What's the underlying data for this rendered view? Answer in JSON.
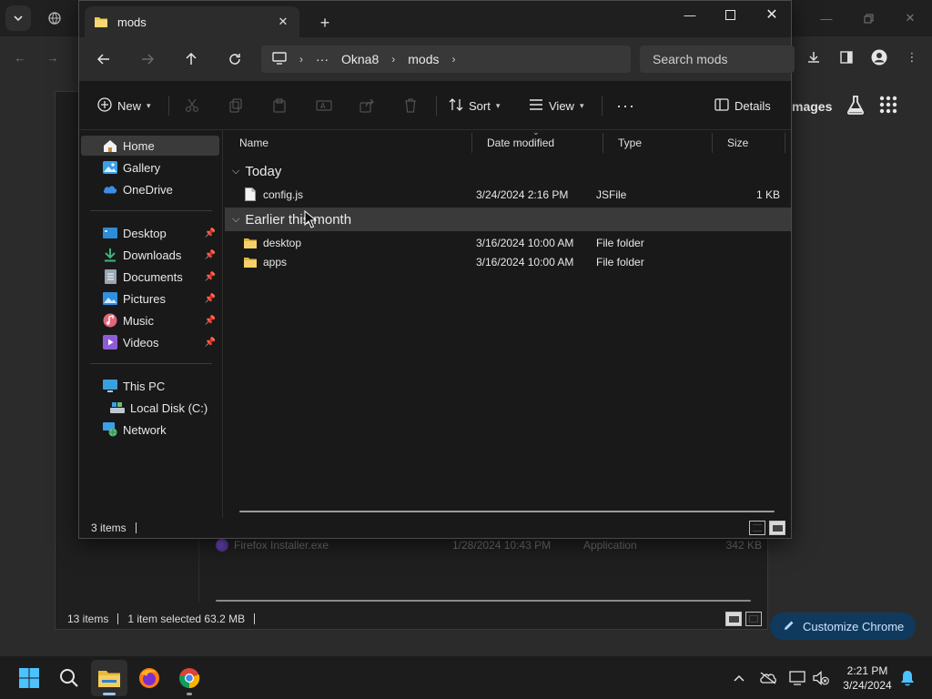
{
  "explorer": {
    "tab_title": "mods",
    "address": {
      "crumbs": [
        "Okna8",
        "mods"
      ]
    },
    "search_placeholder": "Search mods",
    "commands": {
      "new": "New",
      "sort": "Sort",
      "view": "View",
      "details": "Details"
    },
    "nav": {
      "home": "Home",
      "gallery": "Gallery",
      "onedrive": "OneDrive",
      "desktop": "Desktop",
      "downloads": "Downloads",
      "documents": "Documents",
      "pictures": "Pictures",
      "music": "Music",
      "videos": "Videos",
      "thispc": "This PC",
      "localdisk": "Local Disk (C:)",
      "network": "Network"
    },
    "columns": {
      "name": "Name",
      "date": "Date modified",
      "type": "Type",
      "size": "Size"
    },
    "groups": [
      {
        "label": "Today",
        "files": [
          {
            "name": "config.js",
            "date": "3/24/2024 2:16 PM",
            "type": "JSFile",
            "size": "1 KB"
          }
        ]
      },
      {
        "label": "Earlier this month",
        "files": [
          {
            "name": "desktop",
            "date": "3/16/2024 10:00 AM",
            "type": "File folder",
            "size": ""
          },
          {
            "name": "apps",
            "date": "3/16/2024 10:00 AM",
            "type": "File folder",
            "size": ""
          }
        ]
      }
    ],
    "status": "3 items"
  },
  "background": {
    "images_link": "mages",
    "row": {
      "name": "Firefox Installer.exe",
      "date": "1/28/2024 10:43 PM",
      "type": "Application",
      "size": "342 KB"
    },
    "status_count": "13 items",
    "status_selected": "1 item selected  63.2 MB",
    "customize": "Customize Chrome"
  },
  "taskbar": {
    "time": "2:21 PM",
    "date": "3/24/2024"
  },
  "colors": {
    "accent": "#4cc2ff",
    "folder": "#f2c94c",
    "customize_bg": "#0f3a5e"
  }
}
